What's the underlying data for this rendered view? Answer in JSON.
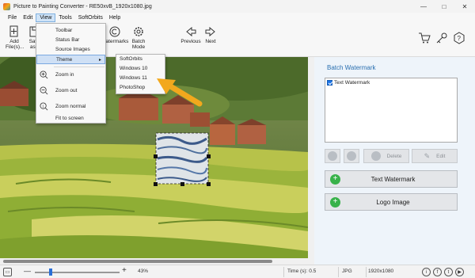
{
  "window": {
    "title": "Picture to Painting Converter - RE50xvB_1920x1080.jpg",
    "controls": [
      "—",
      "□",
      "✕"
    ]
  },
  "menubar": [
    "File",
    "Edit",
    "View",
    "Tools",
    "SoftOrbits",
    "Help"
  ],
  "toolbar": {
    "add_files": "Add File(s)...",
    "save_as": "Save as...",
    "watermarks": "Watermarks",
    "batch_mode": "Batch Mode",
    "previous": "Previous",
    "next": "Next"
  },
  "view_menu": {
    "items": [
      "Toolbar",
      "Status Bar",
      "Source Images",
      "Theme",
      "Zoom in",
      "Zoom out",
      "Zoom normal",
      "Fit to screen"
    ],
    "theme_arrow": "▸"
  },
  "theme_submenu": [
    "SoftOrbits",
    "Windows 10",
    "Windows 11",
    "PhotoShop"
  ],
  "panel": {
    "title": "Batch Watermark",
    "list_items": [
      "Text Watermark"
    ],
    "delete_label": "Delete",
    "edit_label": "Edit",
    "text_watermark_button": "Text Watermark",
    "logo_image_button": "Logo Image"
  },
  "statusbar": {
    "zoom_minus": "—",
    "zoom_plus": "+",
    "zoom": "43%",
    "time": "Time (s): 0.5",
    "format": "JPG",
    "resolution": "1920x1080"
  },
  "colors": {
    "accent": "#2a6fb0",
    "panel_bg": "#eef4fa",
    "add_green": "#38b24a",
    "arrow_orange": "#f2a81d"
  }
}
